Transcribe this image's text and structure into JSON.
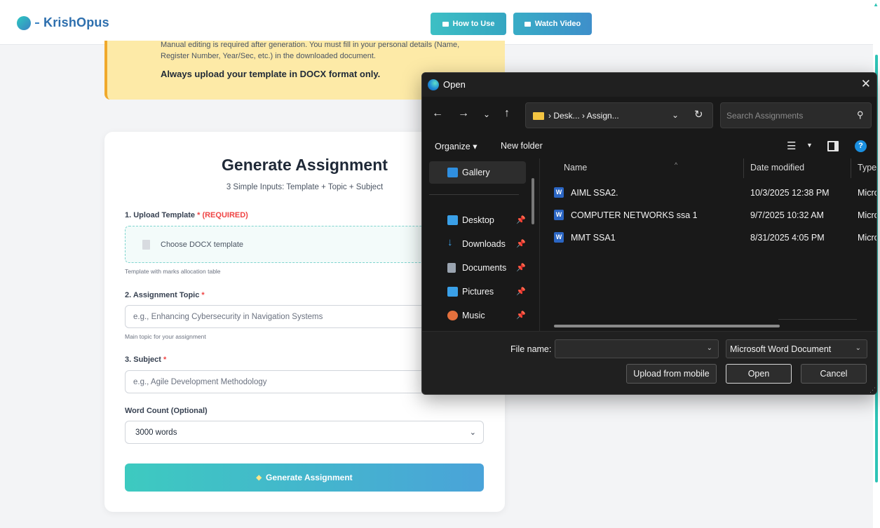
{
  "brand": {
    "name": "KrishOpus"
  },
  "header": {
    "how_to_use": "How to Use",
    "watch_video": "Watch Video"
  },
  "notice": {
    "line1": "Manual editing is required after generation. You must fill in your personal details (Name,",
    "line2": "Register Number, Year/Sec, etc.) in the downloaded document.",
    "strong": "Always upload your template in DOCX format only."
  },
  "form": {
    "title": "Generate Assignment",
    "subtitle": "3 Simple Inputs: Template + Topic + Subject",
    "template_label": "1. Upload Template",
    "template_required": "* (REQUIRED)",
    "template_placeholder": "Choose DOCX template",
    "template_hint": "Template with marks allocation table",
    "topic_label": "2. Assignment Topic",
    "topic_star": "*",
    "topic_placeholder": "e.g., Enhancing Cybersecurity in Navigation Systems",
    "topic_hint": "Main topic for your assignment",
    "subject_label": "3. Subject",
    "subject_star": "*",
    "subject_placeholder": "e.g., Agile Development Methodology",
    "wordcount_label": "Word Count (Optional)",
    "wordcount_value": "3000 words",
    "generate_button": "Generate Assignment"
  },
  "dialog": {
    "title": "Open",
    "close": "✕",
    "breadcrumb": "›  Desk...  ›  Assign...",
    "search_placeholder": "Search Assignments",
    "organize": "Organize ▾",
    "new_folder": "New folder",
    "help": "?",
    "nav_items": [
      {
        "label": "Gallery",
        "color": "#2f8fe0"
      },
      {
        "label": "Desktop",
        "color": "#3aa0e8"
      },
      {
        "label": "Downloads",
        "color": "#3aa0e8"
      },
      {
        "label": "Documents",
        "color": "#9aa4b0"
      },
      {
        "label": "Pictures",
        "color": "#3aa0e8"
      },
      {
        "label": "Music",
        "color": "#e3703d"
      }
    ],
    "columns": {
      "name": "Name",
      "date": "Date modified",
      "type": "Type"
    },
    "files": [
      {
        "name": "AIML SSA2.",
        "date": "10/3/2025 12:38 PM",
        "type": "Micro"
      },
      {
        "name": "COMPUTER NETWORKS ssa 1",
        "date": "9/7/2025 10:32 AM",
        "type": "Micro"
      },
      {
        "name": "MMT  SSA1",
        "date": "8/31/2025 4:05 PM",
        "type": "Micro"
      }
    ],
    "file_name_label": "File name:",
    "file_name_value": "",
    "file_type": "Microsoft Word Document",
    "upload_mobile": "Upload from mobile",
    "open": "Open",
    "cancel": "Cancel"
  }
}
